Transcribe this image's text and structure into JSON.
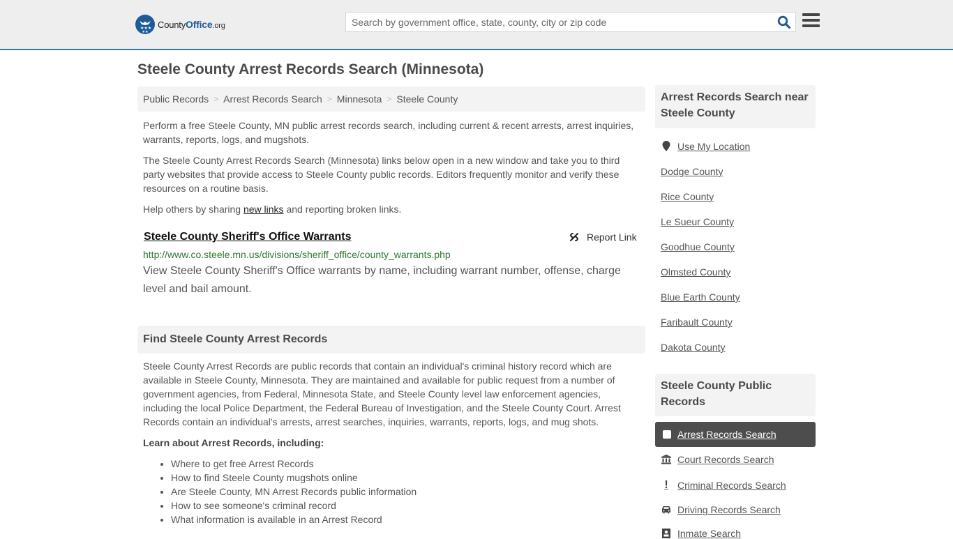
{
  "header": {
    "logo_text_1": "County",
    "logo_text_2": "Office",
    "logo_text_3": ".org",
    "search_placeholder": "Search by government office, state, county, city or zip code",
    "search_value": "",
    "colors": {
      "brand": "#1f5a9a",
      "header_border": "#3877ad"
    }
  },
  "page": {
    "title": "Steele County Arrest Records Search (Minnesota)",
    "breadcrumb": [
      "Public Records",
      "Arrest Records Search",
      "Minnesota",
      "Steele County"
    ],
    "intro_1": "Perform a free Steele County, MN public arrest records search, including current & recent arrests, arrest inquiries, warrants, reports, logs, and mugshots.",
    "intro_2": "The Steele County Arrest Records Search (Minnesota) links below open in a new window and take you to third party websites that provide access to Steele County public records. Editors frequently monitor and verify these resources on a routine basis.",
    "help_prefix": "Help others by sharing ",
    "help_link": "new links",
    "help_suffix": " and reporting broken links."
  },
  "result": {
    "title": "Steele County Sheriff's Office Warrants",
    "report_label": "Report Link",
    "url": "http://www.co.steele.mn.us/divisions/sheriff_office/county_warrants.php",
    "description": "View Steele County Sheriff's Office warrants by name, including warrant number, offense, charge level and bail amount."
  },
  "find_section": {
    "heading": "Find Steele County Arrest Records",
    "body": "Steele County Arrest Records are public records that contain an individual's criminal history record which are available in Steele County, Minnesota. They are maintained and available for public request from a number of government agencies, from Federal, Minnesota State, and Steele County level law enforcement agencies, including the local Police Department, the Federal Bureau of Investigation, and the Steele County Court. Arrest Records contain an individual's arrests, arrest searches, inquiries, warrants, reports, logs, and mug shots.",
    "learn_heading": "Learn about Arrest Records, including:",
    "learn_items": [
      "Where to get free Arrest Records",
      "How to find Steele County mugshots online",
      "Are Steele County, MN Arrest Records public information",
      "How to see someone's criminal record",
      "What information is available in an Arrest Record"
    ]
  },
  "sidebar": {
    "nearby_heading": "Arrest Records Search near Steele County",
    "use_location": "Use My Location",
    "nearby": [
      "Dodge County",
      "Rice County",
      "Le Sueur County",
      "Goodhue County",
      "Olmsted County",
      "Blue Earth County",
      "Faribault County",
      "Dakota County"
    ],
    "public_heading": "Steele County Public Records",
    "public_records": [
      {
        "label": "Arrest Records Search",
        "icon": "square-icon",
        "active": true
      },
      {
        "label": "Court Records Search",
        "icon": "courthouse-icon",
        "active": false
      },
      {
        "label": "Criminal Records Search",
        "icon": "exclamation-icon",
        "active": false
      },
      {
        "label": "Driving Records Search",
        "icon": "car-icon",
        "active": false
      },
      {
        "label": "Inmate Search",
        "icon": "inmate-icon",
        "active": false
      }
    ]
  }
}
